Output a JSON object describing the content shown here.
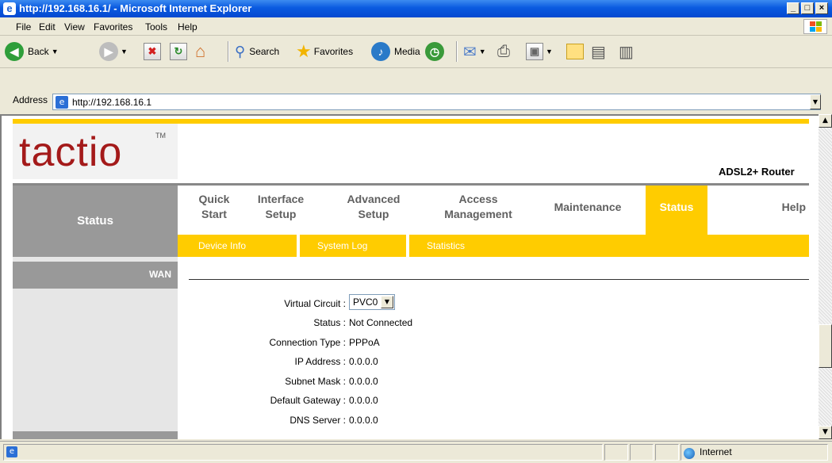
{
  "window": {
    "title": "http://192.168.16.1/ - Microsoft Internet Explorer",
    "min": "_",
    "max": "□",
    "close": "×"
  },
  "menu": [
    "File",
    "Edit",
    "View",
    "Favorites",
    "Tools",
    "Help"
  ],
  "toolbar": {
    "back": "Back",
    "search": "Search",
    "favorites": "Favorites",
    "media": "Media"
  },
  "address": {
    "label": "Address",
    "url": "http://192.168.16.1"
  },
  "router": {
    "logo": "tactio",
    "logo_tm": "TM",
    "product": "ADSL2+ Router",
    "section": "Status",
    "nav": [
      {
        "label": "Quick Start"
      },
      {
        "label": "Interface Setup"
      },
      {
        "label": "Advanced Setup"
      },
      {
        "label": "Access Management"
      },
      {
        "label": "Maintenance"
      },
      {
        "label": "Status"
      },
      {
        "label": "Help"
      }
    ],
    "subnav": [
      "Device Info",
      "System Log",
      "Statistics"
    ],
    "sidebar_heading": "WAN",
    "fields": {
      "virtual_circuit_label": "Virtual Circuit :",
      "virtual_circuit_value": "PVC0",
      "status_label": "Status :",
      "status_value": "Not Connected",
      "conn_type_label": "Connection Type :",
      "conn_type_value": "PPPoA",
      "ip_label": "IP Address :",
      "ip_value": "0.0.0.0",
      "subnet_label": "Subnet Mask :",
      "subnet_value": "0.0.0.0",
      "gateway_label": "Default Gateway :",
      "gateway_value": "0.0.0.0",
      "dns_label": "DNS Server :",
      "dns_value": "0.0.0.0"
    }
  },
  "statusbar": {
    "zone": "Internet"
  },
  "colors": {
    "accent": "#ffcc00",
    "sidebar_dark": "#999999",
    "sidebar_light": "#e6e6e6"
  }
}
